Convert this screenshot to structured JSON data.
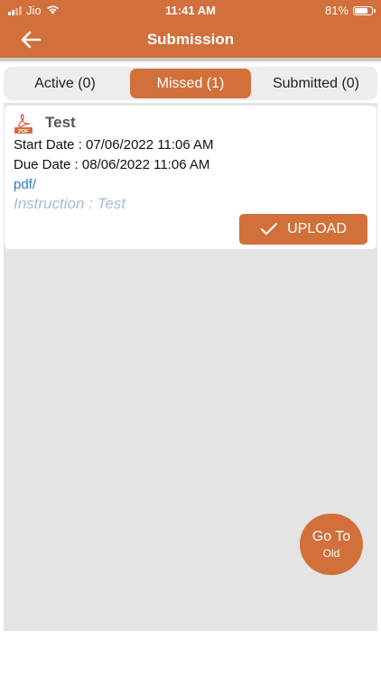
{
  "status_bar": {
    "carrier": "Jio",
    "time": "11:41 AM",
    "battery_text": "81%",
    "battery_level": 0.81
  },
  "header": {
    "title": "Submission",
    "back_icon": "arrow-left-icon"
  },
  "tabs": [
    {
      "label": "Active (0)",
      "active": false
    },
    {
      "label": "Missed (1)",
      "active": true
    },
    {
      "label": "Submitted (0)",
      "active": false
    }
  ],
  "submission": {
    "title": "Test",
    "file_icon": "pdf-icon",
    "start_date": "Start Date : 07/06/2022 11:06 AM",
    "due_date": "Due Date : 08/06/2022 11:06 AM",
    "link_text": "pdf/",
    "instruction": "Instruction : Test",
    "upload_label": "UPLOAD"
  },
  "fab": {
    "line1": "Go To",
    "line2": "Old"
  },
  "colors": {
    "accent": "#d2703b",
    "link": "#2a7ec4",
    "instruction": "#a9bad8",
    "content_bg": "#e4e4e4"
  }
}
